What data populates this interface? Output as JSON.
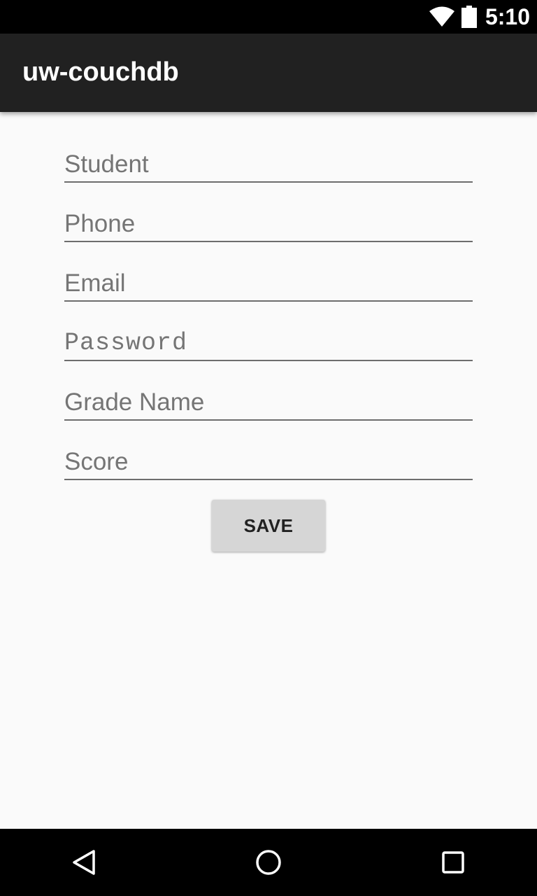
{
  "status_bar": {
    "time": "5:10",
    "icons": [
      "wifi-icon",
      "battery-icon"
    ]
  },
  "app_bar": {
    "title": "uw-couchdb"
  },
  "form": {
    "fields": [
      {
        "name": "student",
        "value": "",
        "placeholder": "Student"
      },
      {
        "name": "phone",
        "value": "",
        "placeholder": "Phone"
      },
      {
        "name": "email",
        "value": "",
        "placeholder": "Email"
      },
      {
        "name": "password",
        "value": "",
        "placeholder": "Password"
      },
      {
        "name": "grade-name",
        "value": "",
        "placeholder": "Grade Name"
      },
      {
        "name": "score",
        "value": "",
        "placeholder": "Score"
      }
    ],
    "save_label": "SAVE"
  },
  "nav_bar": {
    "icons": [
      "back-icon",
      "home-icon",
      "recents-icon"
    ]
  },
  "colors": {
    "status_bar_bg": "#000000",
    "app_bar_bg": "#212121",
    "page_bg": "#fafafa",
    "button_bg": "#d6d6d6",
    "hint_text": "#757575"
  }
}
